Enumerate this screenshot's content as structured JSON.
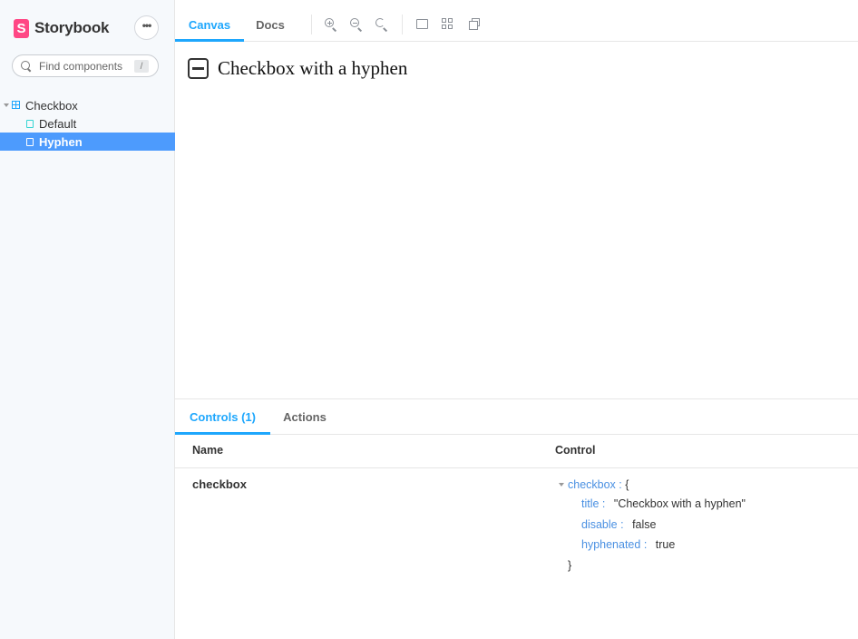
{
  "sidebar": {
    "brand": {
      "logo_letter": "S",
      "name": "Storybook"
    },
    "menu_label": "•••",
    "search": {
      "placeholder": "Find components",
      "shortcut": "/"
    },
    "tree": {
      "component": {
        "label": "Checkbox"
      },
      "stories": [
        {
          "label": "Default",
          "selected": false
        },
        {
          "label": "Hyphen",
          "selected": true
        }
      ]
    }
  },
  "toolbar": {
    "tabs": [
      {
        "label": "Canvas",
        "active": true
      },
      {
        "label": "Docs",
        "active": false
      }
    ],
    "icons": [
      "zoom-in-icon",
      "zoom-out-icon",
      "zoom-reset-icon",
      "background-icon",
      "grid-icon",
      "outline-icon"
    ]
  },
  "preview": {
    "checkbox_state": "indeterminate",
    "label": "Checkbox with a hyphen"
  },
  "panel": {
    "tabs": [
      {
        "label": "Controls (1)",
        "active": true
      },
      {
        "label": "Actions",
        "active": false
      }
    ],
    "columns": {
      "name": "Name",
      "control": "Control"
    },
    "rows": [
      {
        "name": "checkbox",
        "control": {
          "root_key": "checkbox",
          "root_sep": " :",
          "open_brace": "{",
          "close_brace": "}",
          "fields": [
            {
              "key": "title",
              "sep": " :",
              "value": "\"Checkbox with a hyphen\""
            },
            {
              "key": "disable",
              "sep": " :",
              "value": "false"
            },
            {
              "key": "hyphenated",
              "sep": " :",
              "value": "true"
            }
          ]
        }
      }
    ]
  },
  "colors": {
    "accent": "#1ea7fd",
    "selection": "#4d9bfd",
    "brand": "#ff4785",
    "json_key": "#4a90e2",
    "sidebar_bg": "#f6f9fc"
  }
}
